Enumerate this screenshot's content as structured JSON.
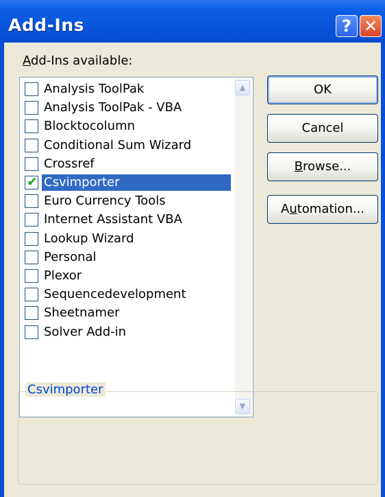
{
  "window": {
    "title": "Add-Ins"
  },
  "titlebar": {
    "help_label": "?",
    "close_label": "✕"
  },
  "list": {
    "label_accesskey": "A",
    "label_rest": "dd-Ins available:",
    "items": [
      {
        "label": "Analysis ToolPak",
        "checked": false,
        "selected": false
      },
      {
        "label": "Analysis ToolPak - VBA",
        "checked": false,
        "selected": false
      },
      {
        "label": "Blocktocolumn",
        "checked": false,
        "selected": false
      },
      {
        "label": "Conditional Sum Wizard",
        "checked": false,
        "selected": false
      },
      {
        "label": "Crossref",
        "checked": false,
        "selected": false
      },
      {
        "label": "Csvimporter",
        "checked": true,
        "selected": true
      },
      {
        "label": "Euro Currency Tools",
        "checked": false,
        "selected": false
      },
      {
        "label": "Internet Assistant VBA",
        "checked": false,
        "selected": false
      },
      {
        "label": "Lookup Wizard",
        "checked": false,
        "selected": false
      },
      {
        "label": "Personal",
        "checked": false,
        "selected": false
      },
      {
        "label": "Plexor",
        "checked": false,
        "selected": false
      },
      {
        "label": "Sequencedevelopment",
        "checked": false,
        "selected": false
      },
      {
        "label": "Sheetnamer",
        "checked": false,
        "selected": false
      },
      {
        "label": "Solver Add-in",
        "checked": false,
        "selected": false
      }
    ],
    "scroll_up_label": "▲",
    "scroll_down_label": "▼"
  },
  "buttons": {
    "ok": "OK",
    "cancel": "Cancel",
    "browse_accesskey": "B",
    "browse_rest": "rowse...",
    "automation_pre": "A",
    "automation_accesskey": "u",
    "automation_rest": "tomation..."
  },
  "description": {
    "title": "Csvimporter",
    "text": ""
  },
  "colors": {
    "titlebar": "#0752d8",
    "dialog_bg": "#ece9d8",
    "selection": "#316ac5",
    "check": "#21a121",
    "groupbox_title": "#0046d5"
  },
  "icons": {
    "check": "check-icon",
    "scroll_up": "scroll-up-arrow-icon",
    "scroll_down": "scroll-down-arrow-icon"
  }
}
